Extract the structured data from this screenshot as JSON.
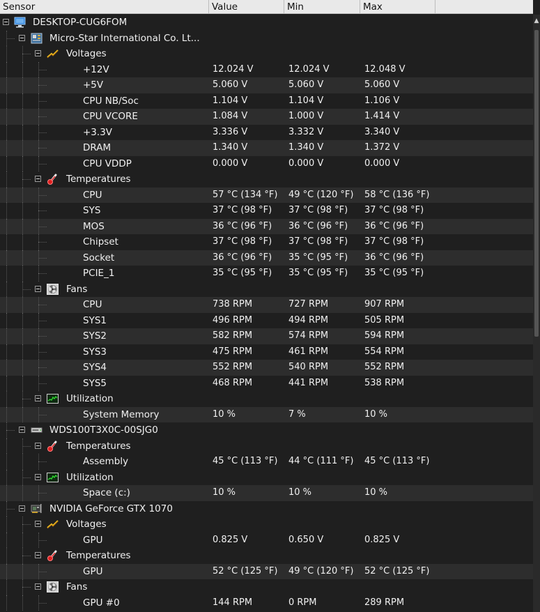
{
  "columns": {
    "sensor": "Sensor",
    "value": "Value",
    "min": "Min",
    "max": "Max"
  },
  "computer": "DESKTOP-CUG6FOM",
  "devices": [
    {
      "name": "Micro-Star International Co. Lt...",
      "icon": "motherboard-icon",
      "groups": [
        {
          "name": "Voltages",
          "icon": "voltage-icon",
          "sensors": [
            {
              "label": "+12V",
              "value": "12.024 V",
              "min": "12.024 V",
              "max": "12.048 V"
            },
            {
              "label": "+5V",
              "value": "5.060 V",
              "min": "5.060 V",
              "max": "5.060 V"
            },
            {
              "label": "CPU NB/Soc",
              "value": "1.104 V",
              "min": "1.104 V",
              "max": "1.106 V"
            },
            {
              "label": "CPU VCORE",
              "value": "1.084 V",
              "min": "1.000 V",
              "max": "1.414 V"
            },
            {
              "label": "+3.3V",
              "value": "3.336 V",
              "min": "3.332 V",
              "max": "3.340 V"
            },
            {
              "label": "DRAM",
              "value": "1.340 V",
              "min": "1.340 V",
              "max": "1.372 V"
            },
            {
              "label": "CPU VDDP",
              "value": "0.000 V",
              "min": "0.000 V",
              "max": "0.000 V"
            }
          ]
        },
        {
          "name": "Temperatures",
          "icon": "thermometer-icon",
          "sensors": [
            {
              "label": "CPU",
              "value": "57 °C  (134 °F)",
              "min": "49 °C  (120 °F)",
              "max": "58 °C  (136 °F)"
            },
            {
              "label": "SYS",
              "value": "37 °C  (98 °F)",
              "min": "37 °C  (98 °F)",
              "max": "37 °C  (98 °F)"
            },
            {
              "label": "MOS",
              "value": "36 °C  (96 °F)",
              "min": "36 °C  (96 °F)",
              "max": "36 °C  (96 °F)"
            },
            {
              "label": "Chipset",
              "value": "37 °C  (98 °F)",
              "min": "37 °C  (98 °F)",
              "max": "37 °C  (98 °F)"
            },
            {
              "label": "Socket",
              "value": "36 °C  (96 °F)",
              "min": "35 °C  (95 °F)",
              "max": "36 °C  (96 °F)"
            },
            {
              "label": "PCIE_1",
              "value": "35 °C  (95 °F)",
              "min": "35 °C  (95 °F)",
              "max": "35 °C  (95 °F)"
            }
          ]
        },
        {
          "name": "Fans",
          "icon": "fan-icon",
          "sensors": [
            {
              "label": "CPU",
              "value": "738 RPM",
              "min": "727 RPM",
              "max": "907 RPM"
            },
            {
              "label": "SYS1",
              "value": "496 RPM",
              "min": "494 RPM",
              "max": "505 RPM"
            },
            {
              "label": "SYS2",
              "value": "582 RPM",
              "min": "574 RPM",
              "max": "594 RPM"
            },
            {
              "label": "SYS3",
              "value": "475 RPM",
              "min": "461 RPM",
              "max": "554 RPM"
            },
            {
              "label": "SYS4",
              "value": "552 RPM",
              "min": "540 RPM",
              "max": "552 RPM"
            },
            {
              "label": "SYS5",
              "value": "468 RPM",
              "min": "441 RPM",
              "max": "538 RPM"
            }
          ]
        },
        {
          "name": "Utilization",
          "icon": "utilization-icon",
          "sensors": [
            {
              "label": "System Memory",
              "value": "10 %",
              "min": "7 %",
              "max": "10 %"
            }
          ]
        }
      ]
    },
    {
      "name": "WDS100T3X0C-00SJG0",
      "icon": "drive-icon",
      "groups": [
        {
          "name": "Temperatures",
          "icon": "thermometer-icon",
          "sensors": [
            {
              "label": "Assembly",
              "value": "45 °C  (113 °F)",
              "min": "44 °C  (111 °F)",
              "max": "45 °C  (113 °F)"
            }
          ]
        },
        {
          "name": "Utilization",
          "icon": "utilization-icon",
          "sensors": [
            {
              "label": "Space (c:)",
              "value": "10 %",
              "min": "10 %",
              "max": "10 %"
            }
          ]
        }
      ]
    },
    {
      "name": "NVIDIA GeForce GTX 1070",
      "icon": "gpu-icon",
      "groups": [
        {
          "name": "Voltages",
          "icon": "voltage-icon",
          "sensors": [
            {
              "label": "GPU",
              "value": "0.825 V",
              "min": "0.650 V",
              "max": "0.825 V"
            }
          ]
        },
        {
          "name": "Temperatures",
          "icon": "thermometer-icon",
          "sensors": [
            {
              "label": "GPU",
              "value": "52 °C  (125 °F)",
              "min": "49 °C  (120 °F)",
              "max": "52 °C  (125 °F)"
            }
          ]
        },
        {
          "name": "Fans",
          "icon": "fan-icon",
          "sensors": [
            {
              "label": "GPU #0",
              "value": "144 RPM",
              "min": "0 RPM",
              "max": "289 RPM"
            }
          ]
        }
      ]
    }
  ]
}
